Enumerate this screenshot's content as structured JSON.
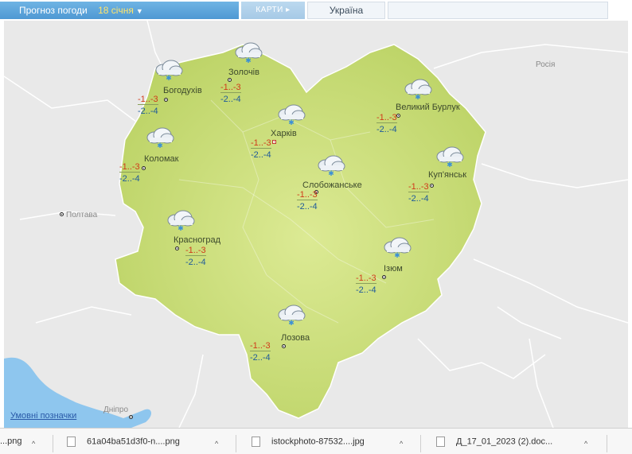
{
  "header": {
    "title": "Прогноз погоди",
    "date": "18 січня",
    "maps_label": "КАРТИ",
    "region_label": "Україна"
  },
  "map": {
    "external_labels": {
      "russia": "Росія",
      "poltava": "Полтава",
      "dnipro": "Дніпро"
    },
    "legend_link": "Умовні позначки",
    "cities": [
      {
        "name": "Богодухів",
        "t_max": "-1..-3",
        "t_min": "-2..-4"
      },
      {
        "name": "Золочів",
        "t_max": "-1..-3",
        "t_min": "-2..-4"
      },
      {
        "name": "Харків",
        "t_max": "-1..-3",
        "t_min": "-2..-4"
      },
      {
        "name": "Великий Бурлук",
        "t_max": "-1..-3",
        "t_min": "-2..-4"
      },
      {
        "name": "Коломак",
        "t_max": "-1..-3",
        "t_min": "-2..-4"
      },
      {
        "name": "Слобожанське",
        "t_max": "-1..-3",
        "t_min": "-2..-4"
      },
      {
        "name": "Куп'янськ",
        "t_max": "-1..-3",
        "t_min": "-2..-4"
      },
      {
        "name": "Красноград",
        "t_max": "-1..-3",
        "t_min": "-2..-4"
      },
      {
        "name": "Ізюм",
        "t_max": "-1..-3",
        "t_min": "-2..-4"
      },
      {
        "name": "Лозова",
        "t_max": "-1..-3",
        "t_min": "-2..-4"
      }
    ],
    "weather_icon": "cloud-snow-icon",
    "colors": {
      "region_fill": "#c8dc78",
      "water": "#8ec6ee",
      "t_max": "#d03a1a",
      "t_min": "#1f5a9a"
    }
  },
  "downloads": [
    {
      "label": "...png"
    },
    {
      "label": "61a04ba51d3f0-n....png"
    },
    {
      "label": "istockphoto-87532....jpg"
    },
    {
      "label": "Д_17_01_2023 (2).doc..."
    }
  ]
}
